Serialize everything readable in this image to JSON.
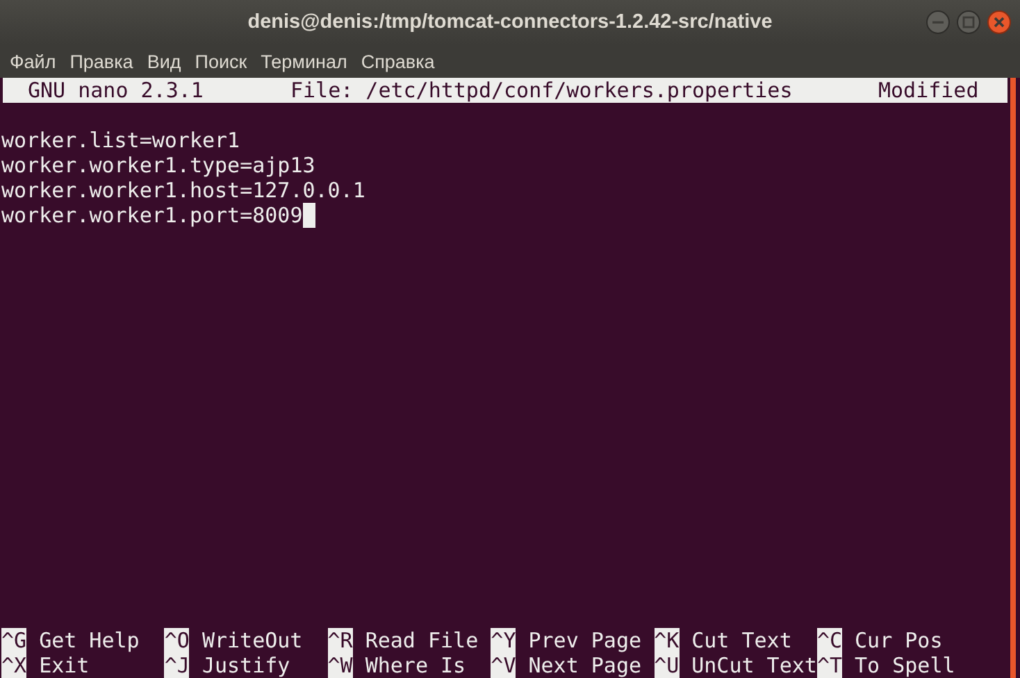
{
  "window": {
    "title": "denis@denis:/tmp/tomcat-connectors-1.2.42-src/native"
  },
  "menu": [
    "Файл",
    "Правка",
    "Вид",
    "Поиск",
    "Терминал",
    "Справка"
  ],
  "nano_header": {
    "version": "GNU nano 2.3.1",
    "file": "File: /etc/httpd/conf/workers.properties",
    "status": "Modified"
  },
  "lines": [
    {
      "text": "worker.list=worker1",
      "cursor": false
    },
    {
      "text": "worker.worker1.type=ajp13",
      "cursor": false
    },
    {
      "text": "worker.worker1.host=127.0.0.1",
      "cursor": false
    },
    {
      "text": "worker.worker1.port=8009",
      "cursor": true
    }
  ],
  "shortcuts": [
    [
      {
        "key": "^G",
        "label": "Get Help"
      },
      {
        "key": "^O",
        "label": "WriteOut"
      },
      {
        "key": "^R",
        "label": "Read File"
      },
      {
        "key": "^Y",
        "label": "Prev Page"
      },
      {
        "key": "^K",
        "label": "Cut Text"
      },
      {
        "key": "^C",
        "label": "Cur Pos"
      }
    ],
    [
      {
        "key": "^X",
        "label": "Exit"
      },
      {
        "key": "^J",
        "label": "Justify"
      },
      {
        "key": "^W",
        "label": "Where Is"
      },
      {
        "key": "^V",
        "label": "Next Page"
      },
      {
        "key": "^U",
        "label": "UnCut Text"
      },
      {
        "key": "^T",
        "label": "To Spell"
      }
    ]
  ]
}
